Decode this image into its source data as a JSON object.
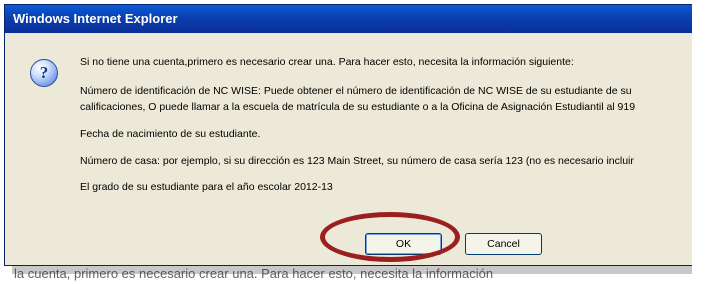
{
  "dialog": {
    "title": "Windows Internet Explorer",
    "lines": [
      "Si no tiene una cuenta,primero es necesario crear una. Para hacer esto, necesita la información  siguiente:",
      " Número de identificación de NC WISE: Puede obtener el número de identificación de NC WISE de su estudiante de su",
      "calificaciones, O puede llamar a la escuela de matrícula de su estudiante o a la Oficina de Asignación Estudiantil al 919",
      "Fecha de nacimiento de su estudiante.",
      "Número de casa: por ejemplo, si su dirección es 123 Main Street, su número de casa sería 123 (no es necesario incluir",
      "El grado de su estudiante para el año escolar 2012-13"
    ],
    "ok_label": "OK",
    "cancel_label": "Cancel"
  },
  "background_text": "la cuenta, primero es necesario crear una. Para hacer esto, necesita la información",
  "colors": {
    "titlebar": "#0a3fb0",
    "dialog_bg": "#ece9d8",
    "highlight_ring": "#9c1f1f"
  },
  "icons": {
    "question": "question-icon"
  }
}
